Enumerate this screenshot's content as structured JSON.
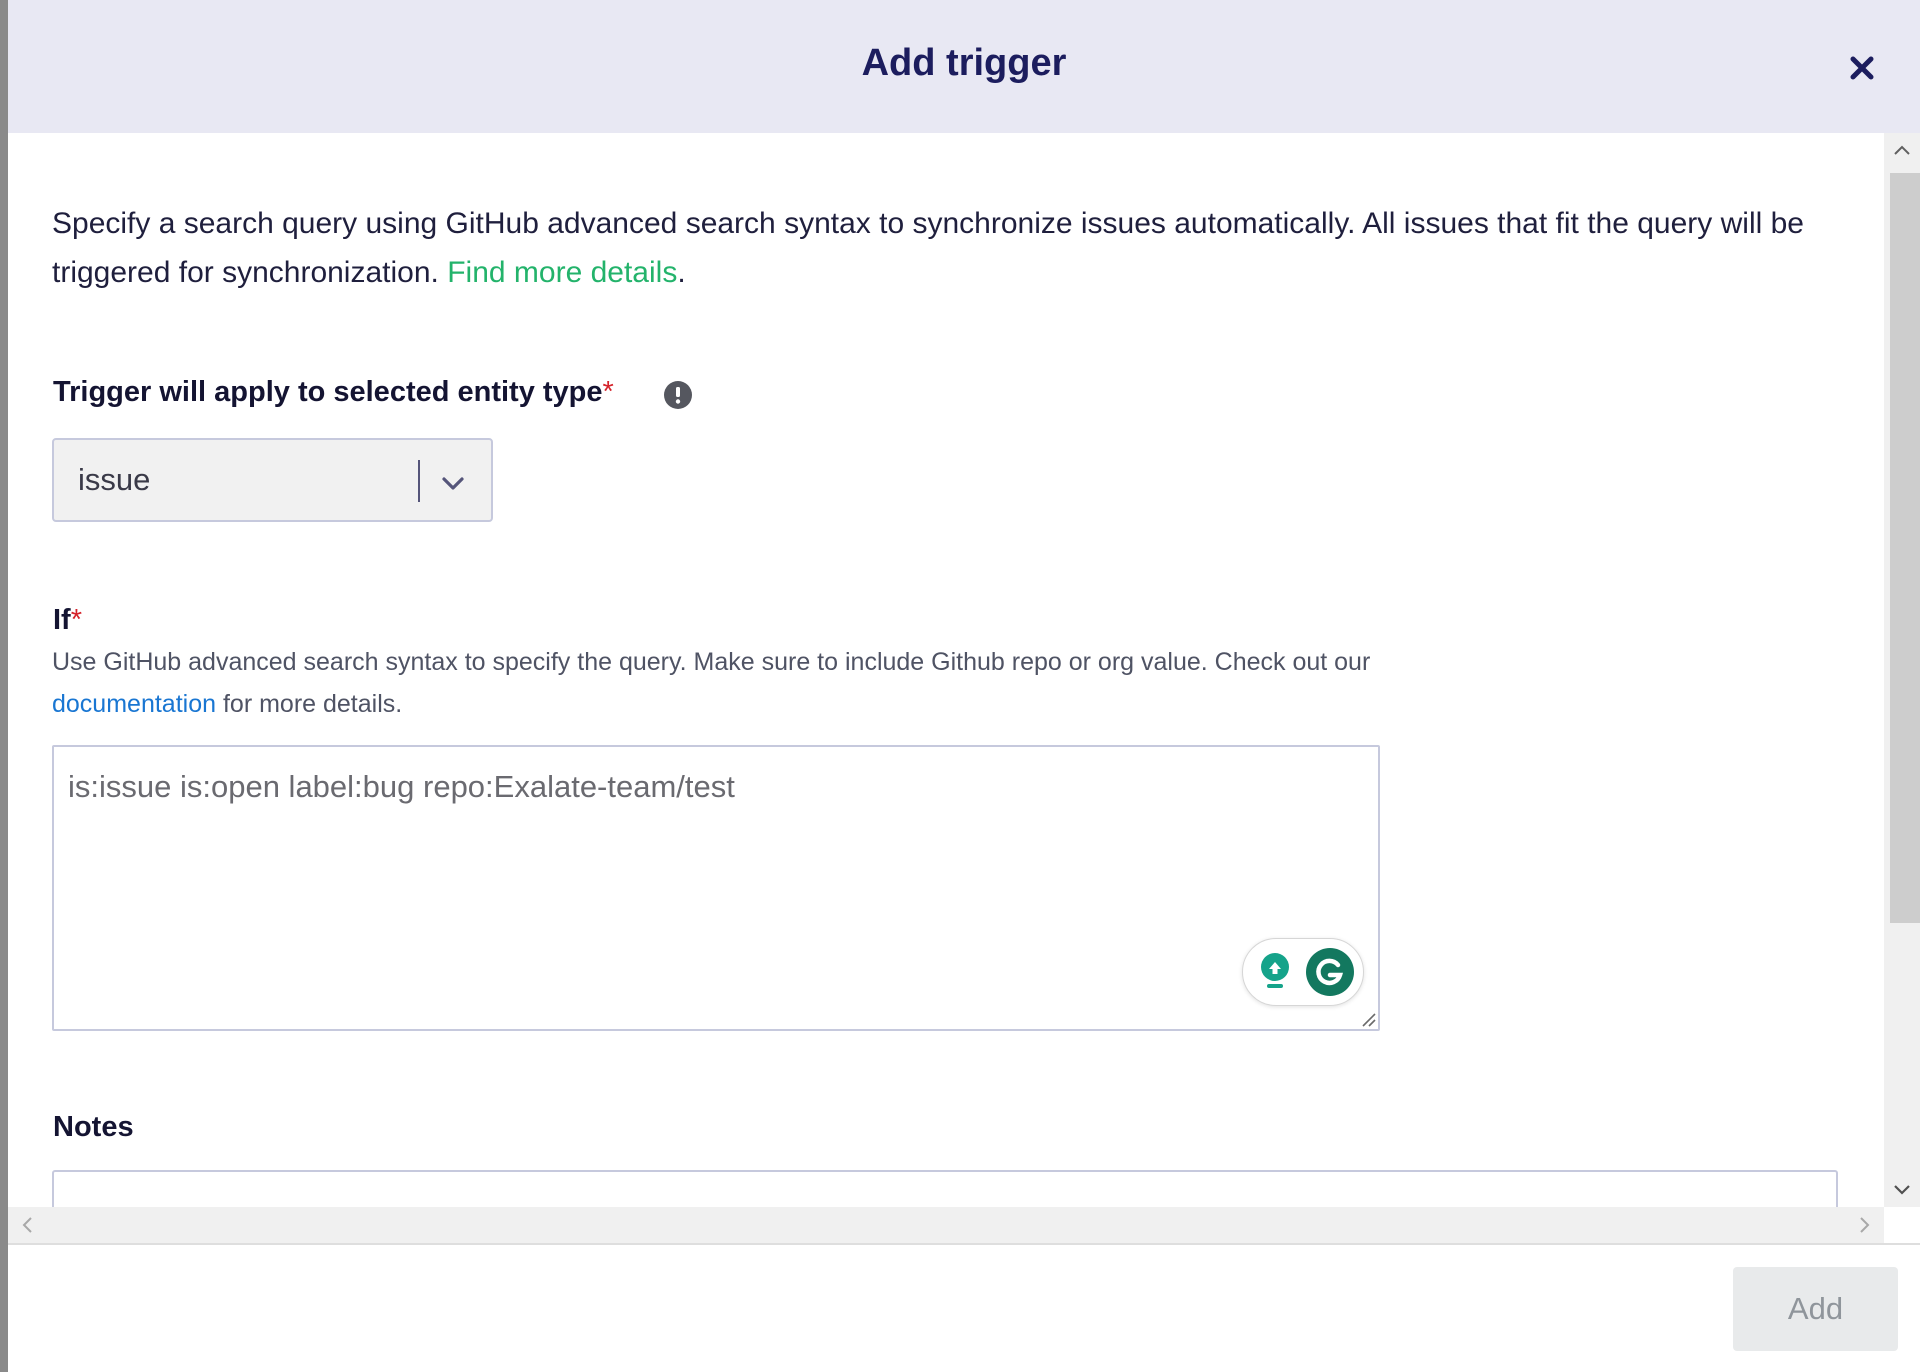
{
  "modal": {
    "title": "Add trigger",
    "close_icon": "close-icon"
  },
  "description": {
    "text": "Specify a search query using GitHub advanced search syntax to synchronize issues automatically. All issues that fit the query will be triggered for synchronization.",
    "link_text": "Find more details",
    "suffix": "."
  },
  "entity_type": {
    "label": "Trigger will apply to selected entity type",
    "required_mark": "*",
    "info_icon": "info-icon",
    "selected_value": "issue"
  },
  "condition": {
    "label": "If",
    "required_mark": "*",
    "helper_prefix": "Use GitHub advanced search syntax to specify the query. Make sure to include Github repo or org value. Check out our",
    "helper_link": "documentation",
    "helper_suffix": "for more details.",
    "query_value": "is:issue is:open label:bug repo:Exalate-team/test"
  },
  "notes": {
    "label": "Notes",
    "value": ""
  },
  "footer": {
    "add_label": "Add"
  },
  "colors": {
    "header_bg": "#e8e8f3",
    "title": "#1c1d5e",
    "link_green": "#23b36b",
    "link_blue": "#1976d2",
    "required": "#d5232b",
    "grammarly": "#15a38a"
  }
}
